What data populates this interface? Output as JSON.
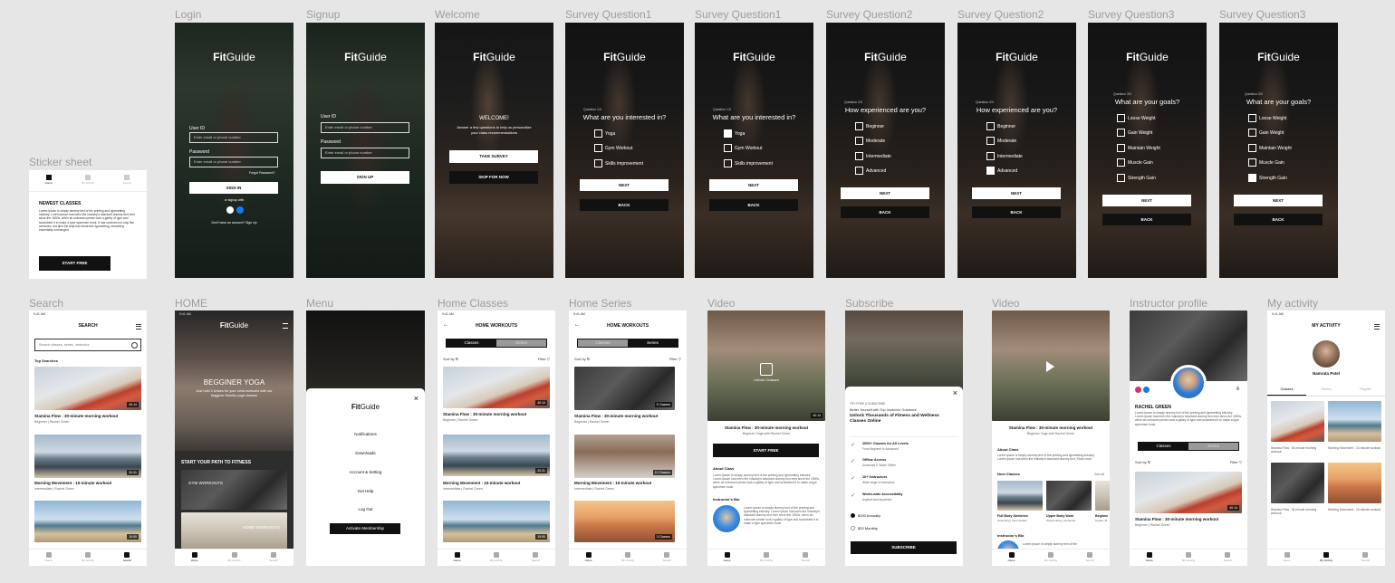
{
  "labels": {
    "login": "Login",
    "signup": "Signup",
    "welcome": "Welcome",
    "sq1a": "Survey Question1",
    "sq1b": "Survey Question1",
    "sq2a": "Survey Question2",
    "sq2b": "Survey Question2",
    "sq3a": "Survey Question3",
    "sq3b": "Survey Question3",
    "sticker": "Sticker sheet",
    "search": "Search",
    "home": "HOME",
    "menu": "Menu",
    "home_classes": "Home Classes",
    "home_series": "Home Series",
    "video1": "Video",
    "subscribe": "Subscribe",
    "video2": "Video",
    "instructor": "Instructor profile",
    "activity": "My activity"
  },
  "logo": {
    "bold": "Fit",
    "rest": "Guide"
  },
  "login": {
    "user_id": "User ID",
    "user_ph": "Enter email or phone number",
    "password": "Password",
    "pass_ph": "Enter email or phone number",
    "forgot": "Forgot Password?",
    "sign_in": "SIGN IN",
    "or": "or signup with",
    "no_account": "Don't have an account? Sign Up"
  },
  "signup": {
    "user_id": "User ID",
    "user_ph": "Enter email or phone number",
    "password": "Password",
    "pass_ph": "Enter email or phone number",
    "sign_up": "SIGN UP"
  },
  "welcome": {
    "title": "WELCOME!",
    "body": "Answer a few questions to help us personalize your class recommendations",
    "take": "TAKE SURVEY",
    "skip": "SKIP FOR NOW"
  },
  "survey": {
    "q1_small": "Question 1/3",
    "q1": "What are you interested in?",
    "q1_opts": [
      "Yoga",
      "Gym Workout",
      "Skills improvement"
    ],
    "q2_small": "Question 2/3",
    "q2": "How experienced are you?",
    "q2_opts": [
      "Beginner",
      "Moderate",
      "Intermediate",
      "Advanced"
    ],
    "q3_small": "Question 3/3",
    "q3": "What are your goals?",
    "q3_opts": [
      "Loose Weight",
      "Gain Weight",
      "Maintain Weight",
      "Muscle Gain",
      "Strength Gain"
    ],
    "next": "NEXT",
    "back": "BACK"
  },
  "sticker": {
    "nav_home": "Home",
    "nav_activity": "My Activity",
    "nav_search": "Search",
    "heading": "NEWEST CLASSES",
    "body": "Lorem Ipsum is simply dummy text of the printing and typesetting industry. Lorem Ipsum has been the industry's standard dummy text ever since the 1500s, when an unknown printer took a galley of type and scrambled it to make a type specimen book. It has survived not only five centuries, but also the leap into electronic typesetting, remaining essentially unchanged.",
    "start": "START FREE"
  },
  "status": {
    "time": "9:41 AM"
  },
  "nav": {
    "home": "Home",
    "activity": "My Activity",
    "search": "Search"
  },
  "search": {
    "title": "SEARCH",
    "placeholder": "Search classes, series, instructor",
    "top": "Top Searches",
    "items": [
      {
        "title": "Stamina Flow : 30-minute morning workout",
        "sub": "Beginner | Rachel Green",
        "time": "40:14"
      },
      {
        "title": "Morning Movement : 10-minute workout",
        "sub": "Intermediate | Rachel Green",
        "time": "20:31"
      },
      {
        "time": "15:50"
      }
    ]
  },
  "home": {
    "hero": "BEGGINER YOGA",
    "hero_sub": "Just hold 3 lenses for your mind workouts with our begginer friendly yoga classes",
    "path": "START YOUR PATH TO FITNESS",
    "card1": "GYM WORKOUTS",
    "card2": "HOME WORKOUTS"
  },
  "menu": {
    "items": [
      "Notifications",
      "Downloads",
      "Account & Setting",
      "Get Help",
      "Log Out"
    ],
    "cta": "Activate Membership"
  },
  "home_classes": {
    "title": "HOME WORKOUTS",
    "tab_classes": "Classes",
    "tab_series": "Series",
    "sort": "Sort by",
    "filter": "Filter",
    "items": [
      {
        "title": "Stamina Flow : 30-minute morning workout",
        "sub": "Beginner | Rachel Green",
        "time": "40:14"
      },
      {
        "title": "Morning Movement : 10-minute workout",
        "sub": "Intermediate | Rachel Green",
        "time": "20:31"
      },
      {
        "time": "15:50"
      }
    ]
  },
  "home_series": {
    "title": "HOME WORKOUTS",
    "tab_classes": "Classes",
    "tab_series": "Series",
    "sort": "Sort by",
    "filter": "Filter",
    "items": [
      {
        "title": "Stamina Flow : 30-minute morning workout",
        "sub": "Beginner | Rachel Green",
        "tag": "5 Classes"
      },
      {
        "title": "Morning Movement : 10-minute workout",
        "sub": "Intermediate | Rachel Green",
        "tag": "10 Classes"
      },
      {
        "tag": "3 Classes"
      }
    ]
  },
  "video1": {
    "unlock": "Unlock Classes",
    "time": "40:14",
    "title": "Stamina Flow : 30-minute morning workout",
    "sub": "Beginner Yoga with Rachel Green",
    "start": "START FREE",
    "about": "About Class",
    "about_body": "Lorem Ipsum is simply dummy text of the printing and typesetting industry. Lorem Ipsum has been the industry's standard dummy text ever since the 1500s, when an unknown printer took a galley of type and scrambled it to make a type specimen book.",
    "bio": "Instructor's Bio",
    "bio_body": "Lorem Ipsum is simply dummy text of the printing and typesetting industry. Lorem Ipsum has been the industry's standard dummy text ever since the 1500s, when an unknown printer took a galley of type and scrambled it to make a type specimen book."
  },
  "subscribe": {
    "small": "TRY FREE & SUBSCRIBE",
    "head_sub": "Better Yourself with Top Instructor Guidance",
    "headline": "Unlock Thousands of Fitness and Wellness Classes Online",
    "features": [
      {
        "t": "2000+ Classes for All Levels",
        "s": "From Beginner to Advanced"
      },
      {
        "t": "Offline Access",
        "s": "Download & Watch Offline"
      },
      {
        "t": "10+ Instructors",
        "s": "Wide range of Instructors"
      },
      {
        "t": "World-wide Accessibility",
        "s": "Anytime and anywhere"
      }
    ],
    "annual": "$200 Annually",
    "monthly": "$20 Monthly",
    "cta": "SUBSCRIBE"
  },
  "video2": {
    "title": "Stamina Flow : 30-minute morning workout",
    "sub": "Beginner Yoga with Rachel Green",
    "about": "About Class",
    "about_body": "Lorem ipsum is simply dummy text of the printing and typesetting industry. Lorem Ipsum has been the industry's standard dummy text. Show more",
    "next": "Next Classes",
    "see_all": "See all",
    "next_items": [
      {
        "t": "Full Body Stretches",
        "s": "Stretching | Intermediate"
      },
      {
        "t": "Upper Body Work",
        "s": "Weight lifting | Moderate"
      },
      {
        "t": "Beginne",
        "s": "Cardio | B"
      }
    ],
    "bio": "Instructor's Bio",
    "bio_body": "Lorem Ipsum is simply dummy text of the"
  },
  "instructor": {
    "name": "RACHEL GREEN",
    "body": "Lorem Ipsum is simply dummy text of the printing and typesetting industry. Lorem Ipsum has been the industry's standard dummy text ever since the 1500s, when an unknown printer took a galley of type and scrambled it to make a type specimen book.",
    "tab_classes": "Classes",
    "tab_series": "Series",
    "sort": "Sort by",
    "filter": "Filter",
    "time": "40:14",
    "item_title": "Stamina Flow : 30-minute morning workout",
    "item_sub": "Beginner | Rachel Green"
  },
  "activity": {
    "title": "MY ACTIVITY",
    "name": "Namrata Patel",
    "tabs": [
      "Classes",
      "Series",
      "Playlist"
    ],
    "items": [
      "Stamina Flow : 30-minute morning workout",
      "Morning Movement : 10-minute workout",
      "Stamina Flow : 30-minute morning workout",
      "Morning Movement : 10-minute workout"
    ]
  }
}
